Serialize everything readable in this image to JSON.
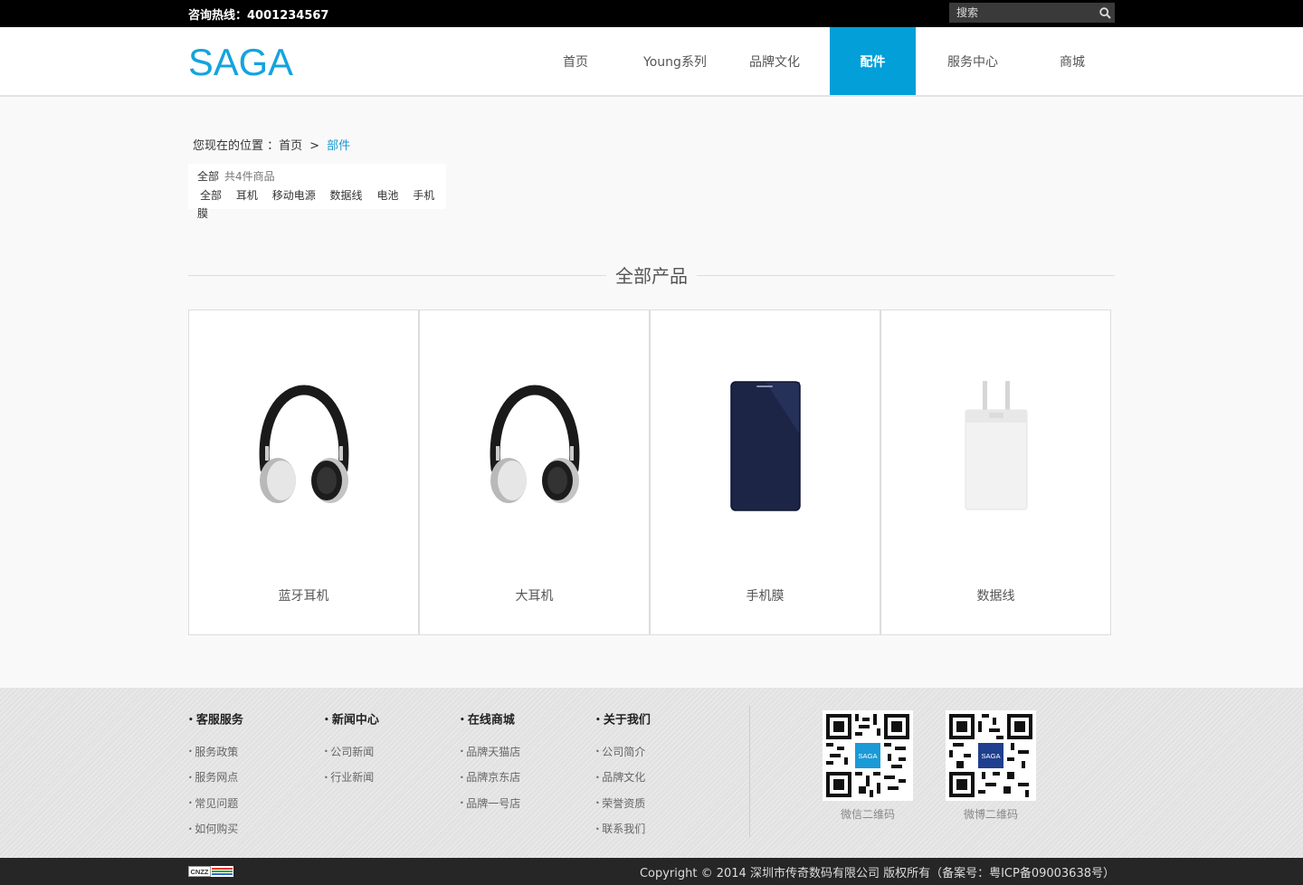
{
  "topbar": {
    "hotline_label": "咨询热线：",
    "hotline_number": "4001234567",
    "search_placeholder": "搜索"
  },
  "header": {
    "logo_text": "SAGA",
    "nav": [
      {
        "label": "首页"
      },
      {
        "label": "Young系列"
      },
      {
        "label": "品牌文化"
      },
      {
        "label": "配件",
        "active": true
      },
      {
        "label": "服务中心"
      },
      {
        "label": "商城"
      }
    ]
  },
  "breadcrumb": {
    "prefix": "您现在的位置 ：",
    "home": "首页",
    "sep": ">",
    "current": "部件"
  },
  "filter": {
    "title": "全部",
    "count": "共4件商品",
    "tags": [
      "全部",
      "耳机",
      "移动电源",
      "数据线",
      "电池",
      "手机膜"
    ]
  },
  "section": {
    "title": "全部产品"
  },
  "products": [
    {
      "name": "蓝牙耳机",
      "icon": "headphones-icon"
    },
    {
      "name": "大耳机",
      "icon": "headphones-icon"
    },
    {
      "name": "手机膜",
      "icon": "phone-case-icon"
    },
    {
      "name": "数据线",
      "icon": "charger-icon"
    }
  ],
  "footer": {
    "columns": [
      {
        "title": "客服服务",
        "links": [
          "服务政策",
          "服务网点",
          "常见问题",
          "如何购买"
        ]
      },
      {
        "title": "新闻中心",
        "links": [
          "公司新闻",
          "行业新闻"
        ]
      },
      {
        "title": "在线商城",
        "links": [
          "品牌天猫店",
          "品牌京东店",
          "品牌一号店"
        ]
      },
      {
        "title": "关于我们",
        "links": [
          "公司简介",
          "品牌文化",
          "荣誉资质",
          "联系我们"
        ]
      }
    ],
    "qrcodes": [
      {
        "label": "微信二维码",
        "badge": "SAGA",
        "badge_color": "#1a9ad6"
      },
      {
        "label": "微博二维码",
        "badge": "SAGA",
        "badge_color": "#1f3f8f"
      }
    ],
    "cnzz": "CNZZ",
    "copyright": "Copyright © 2014 深圳市传奇数码有限公司 版权所有（备案号：粤ICP备09003638号）"
  },
  "colors": {
    "accent": "#029fd9",
    "topbar": "#000000",
    "bottombar": "#262626"
  }
}
